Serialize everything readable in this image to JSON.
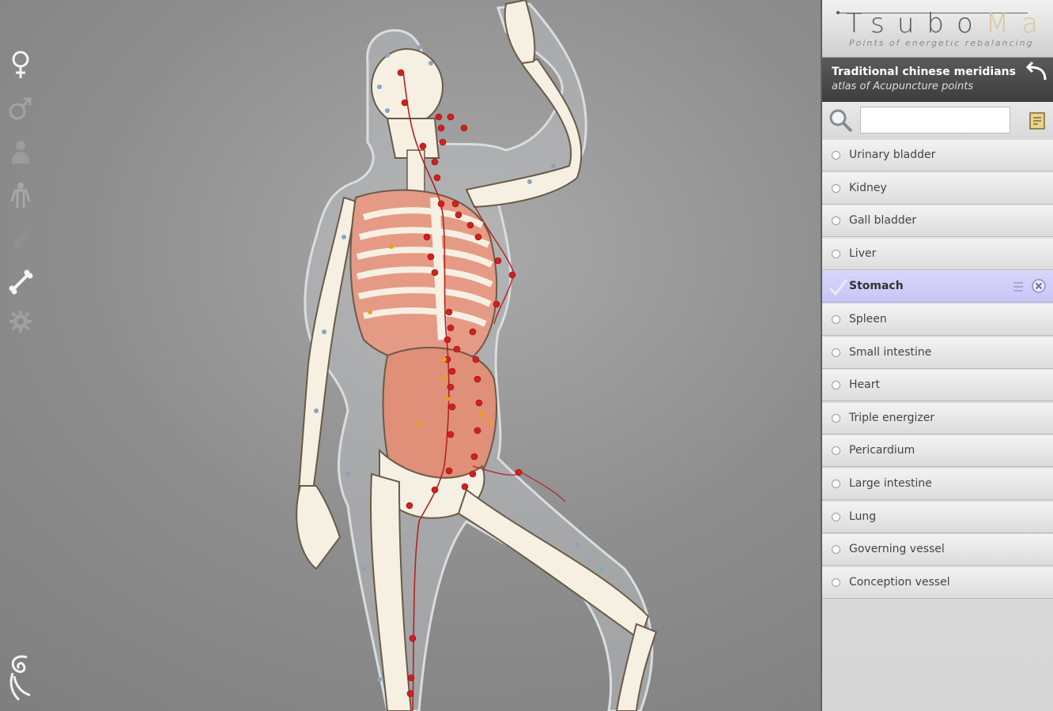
{
  "app": {
    "brand_title_a": "Tsubo",
    "brand_title_b": "Map",
    "brand_subtitle": "Points of energetic rebalancing"
  },
  "header": {
    "title": "Traditional chinese meridians",
    "subtitle": "atlas of Acupuncture points"
  },
  "search": {
    "value": "",
    "placeholder": ""
  },
  "toolbar": {
    "items": [
      {
        "icon": "female-icon"
      },
      {
        "icon": "male-icon"
      },
      {
        "icon": "body-icon"
      },
      {
        "icon": "anatomy-icon"
      },
      {
        "icon": "muscle-icon"
      },
      {
        "icon": "bone-icon"
      },
      {
        "icon": "gear-icon"
      }
    ]
  },
  "meridians": {
    "items": [
      {
        "label": "Urinary bladder",
        "selected": false
      },
      {
        "label": "Kidney",
        "selected": false
      },
      {
        "label": "Gall bladder",
        "selected": false
      },
      {
        "label": "Liver",
        "selected": false
      },
      {
        "label": "Stomach",
        "selected": true
      },
      {
        "label": "Spleen",
        "selected": false
      },
      {
        "label": "Small intestine",
        "selected": false
      },
      {
        "label": "Heart",
        "selected": false
      },
      {
        "label": "Triple energizer",
        "selected": false
      },
      {
        "label": "Pericardium",
        "selected": false
      },
      {
        "label": "Large intestine",
        "selected": false
      },
      {
        "label": "Lung",
        "selected": false
      },
      {
        "label": "Governing vessel",
        "selected": false
      },
      {
        "label": "Conception vessel",
        "selected": false
      }
    ]
  },
  "colors": {
    "selected_row": "#cbc8f7",
    "point_red": "#d51f1f",
    "point_yellow": "#e8a21a",
    "organ": "#e59a85",
    "bone": "#f6f0e2"
  }
}
